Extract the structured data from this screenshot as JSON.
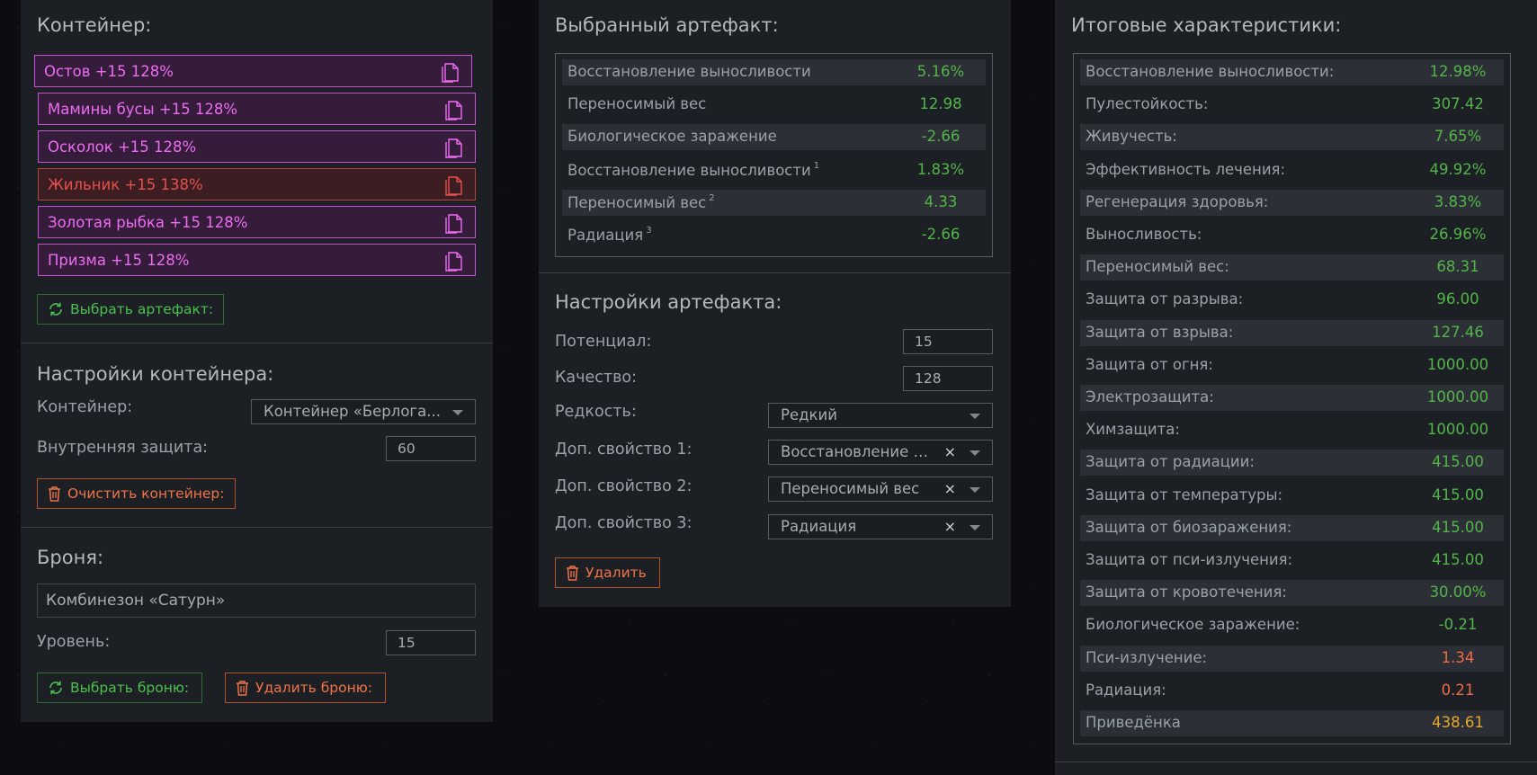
{
  "container_section": {
    "title": "Контейнер:",
    "artifacts": [
      {
        "label": "Остов +15 128%",
        "warn": false
      },
      {
        "label": "Мамины бусы +15 128%",
        "warn": false
      },
      {
        "label": "Осколок +15 128%",
        "warn": false
      },
      {
        "label": "Жильник +15 138%",
        "warn": true
      },
      {
        "label": "Золотая рыбка +15 128%",
        "warn": false
      },
      {
        "label": "Призма +15 128%",
        "warn": false
      }
    ],
    "select_artifact_button": "Выбрать артефакт:"
  },
  "container_settings": {
    "title": "Настройки контейнера:",
    "container_label": "Контейнер:",
    "container_value": "Контейнер «Берлога...",
    "inner_protection_label": "Внутренняя защита:",
    "inner_protection_value": "60",
    "clear_button": "Очистить контейнер:"
  },
  "armor": {
    "title": "Броня:",
    "name": "Комбинезон «Сатурн»",
    "level_label": "Уровень:",
    "level_value": "15",
    "select_button": "Выбрать броню:",
    "delete_button": "Удалить броню:"
  },
  "selected_artifact": {
    "title": "Выбранный артефакт:",
    "rows": [
      {
        "label": "Восстановление выносливости",
        "sup": "",
        "value": "5.16%",
        "tone": "pos"
      },
      {
        "label": "Переносимый вес",
        "sup": "",
        "value": "12.98",
        "tone": "pos"
      },
      {
        "label": "Биологическое заражение",
        "sup": "",
        "value": "-2.66",
        "tone": "pos"
      },
      {
        "label": "Восстановление выносливости",
        "sup": "1",
        "value": "1.83%",
        "tone": "pos"
      },
      {
        "label": "Переносимый вес",
        "sup": "2",
        "value": "4.33",
        "tone": "pos"
      },
      {
        "label": "Радиация",
        "sup": "3",
        "value": "-2.66",
        "tone": "pos"
      }
    ]
  },
  "artifact_settings": {
    "title": "Настройки артефакта:",
    "potential_label": "Потенциал:",
    "potential_value": "15",
    "quality_label": "Качество:",
    "quality_value": "128",
    "rarity_label": "Редкость:",
    "rarity_value": "Редкий",
    "extra1_label": "Доп. свойство 1:",
    "extra1_value": "Восстановление выносливости",
    "extra2_label": "Доп. свойство 2:",
    "extra2_value": "Переносимый вес",
    "extra3_label": "Доп. свойство 3:",
    "extra3_value": "Радиация",
    "delete_button": "Удалить"
  },
  "totals": {
    "title": "Итоговые характеристики:",
    "rows": [
      {
        "label": "Восстановление выносливости:",
        "value": "12.98%",
        "tone": "pos"
      },
      {
        "label": "Пулестойкость:",
        "value": "307.42",
        "tone": "pos"
      },
      {
        "label": "Живучесть:",
        "value": "7.65%",
        "tone": "pos"
      },
      {
        "label": "Эффективность лечения:",
        "value": "49.92%",
        "tone": "pos"
      },
      {
        "label": "Регенерация здоровья:",
        "value": "3.83%",
        "tone": "pos"
      },
      {
        "label": "Выносливость:",
        "value": "26.96%",
        "tone": "pos"
      },
      {
        "label": "Переносимый вес:",
        "value": "68.31",
        "tone": "pos"
      },
      {
        "label": "Защита от разрыва:",
        "value": "96.00",
        "tone": "pos"
      },
      {
        "label": "Защита от взрыва:",
        "value": "127.46",
        "tone": "pos"
      },
      {
        "label": "Защита от огня:",
        "value": "1000.00",
        "tone": "pos"
      },
      {
        "label": "Электрозащита:",
        "value": "1000.00",
        "tone": "pos"
      },
      {
        "label": "Химзащита:",
        "value": "1000.00",
        "tone": "pos"
      },
      {
        "label": "Защита от радиации:",
        "value": "415.00",
        "tone": "pos"
      },
      {
        "label": "Защита от температуры:",
        "value": "415.00",
        "tone": "pos"
      },
      {
        "label": "Защита от биозаражения:",
        "value": "415.00",
        "tone": "pos"
      },
      {
        "label": "Защита от пси-излучения:",
        "value": "415.00",
        "tone": "pos"
      },
      {
        "label": "Защита от кровотечения:",
        "value": "30.00%",
        "tone": "pos"
      },
      {
        "label": "Биологическое заражение:",
        "value": "-0.21",
        "tone": "pos"
      },
      {
        "label": "Пси-излучение:",
        "value": "1.34",
        "tone": "neg"
      },
      {
        "label": "Радиация:",
        "value": "0.21",
        "tone": "neg"
      },
      {
        "label": "Приведёнка",
        "value": "438.61",
        "tone": "gold"
      }
    ]
  },
  "colors": {
    "artifact_normal": "#ee6cf3",
    "artifact_warn": "#e5504b",
    "positive": "#52b548",
    "negative": "#f06a45",
    "gold": "#e6a62c"
  },
  "icons": {
    "copy": "copy-icon",
    "refresh": "refresh-icon",
    "trash": "trash-icon",
    "clear": "clear-x-icon",
    "dropdown": "chevron-down-icon"
  }
}
